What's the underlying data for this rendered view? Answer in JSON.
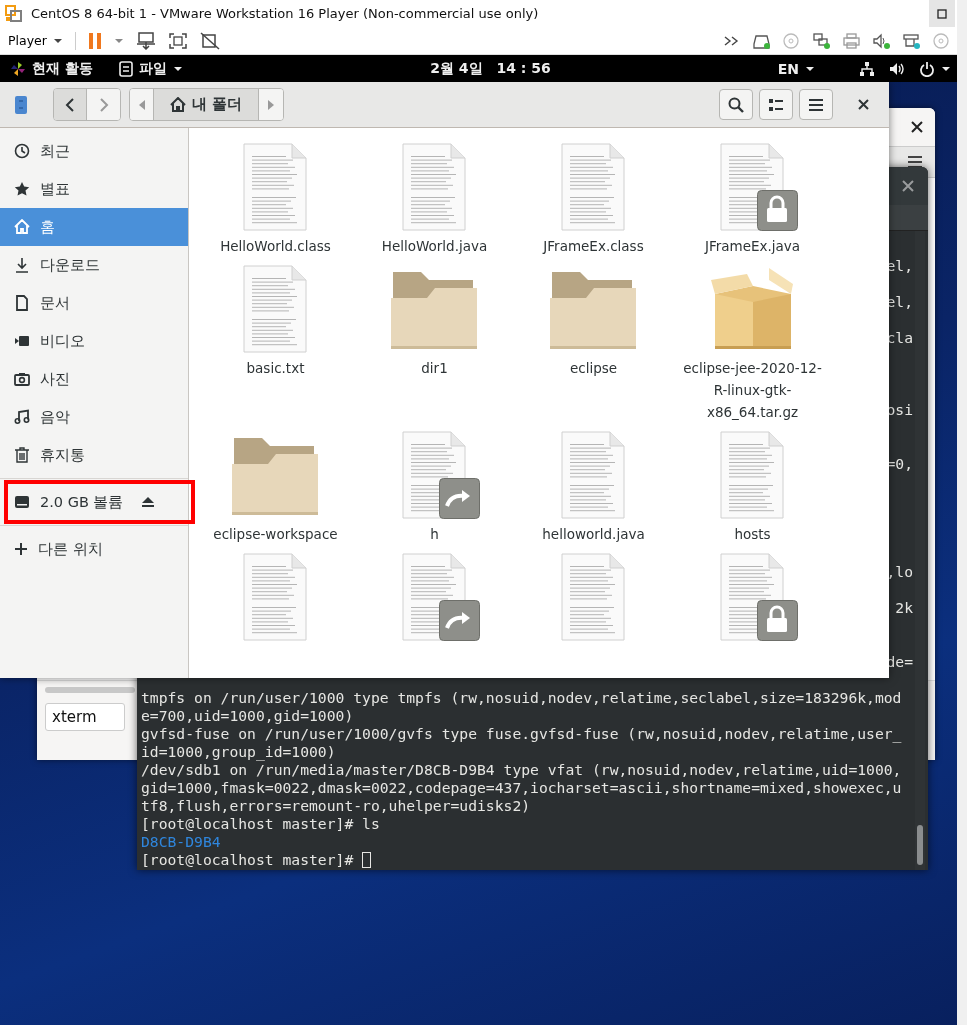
{
  "vm_window": {
    "title": "CentOS 8 64-bit 1 - VMware Workstation 16 Player (Non-commercial use only)",
    "menu": "Player"
  },
  "top_bar": {
    "activities": "현재 활동",
    "app_menu": "파일",
    "date": "2월 4일",
    "time": "14 : 56",
    "input_source": "EN"
  },
  "back_window": {
    "input_value": "xterm"
  },
  "terminal": {
    "clipped_lines": [
      "el,",
      "el,",
      "cla",
      "osi",
      "=0,",
      ",lo",
      "2k",
      "de="
    ],
    "lines": [
      {
        "text": "tmpfs on /run/user/1000 type tmpfs (rw,nosuid,nodev,relatime,seclabel,size=183296k,mod",
        "kind": "output"
      },
      {
        "text": "e=700,uid=1000,gid=1000)",
        "kind": "output"
      },
      {
        "text": "gvfsd-fuse on /run/user/1000/gvfs type fuse.gvfsd-fuse (rw,nosuid,nodev,relatime,user_",
        "kind": "output"
      },
      {
        "text": "id=1000,group_id=1000)",
        "kind": "output"
      },
      {
        "text": "/dev/sdb1 on /run/media/master/D8CB-D9B4 type vfat (rw,nosuid,nodev,relatime,uid=1000,",
        "kind": "output"
      },
      {
        "text": "gid=1000,fmask=0022,dmask=0022,codepage=437,iocharset=ascii,shortname=mixed,showexec,u",
        "kind": "output"
      },
      {
        "text": "tf8,flush,errors=remount-ro,uhelper=udisks2)",
        "kind": "output"
      },
      {
        "text": "[root@localhost master]# ls",
        "kind": "output"
      },
      {
        "text": "D8CB-D9B4",
        "kind": "directory"
      },
      {
        "text": "[root@localhost master]# ",
        "kind": "output"
      }
    ],
    "cursor": true
  },
  "files": {
    "path": "내 폴더",
    "sidebar": [
      {
        "label": "최근",
        "selected": false
      },
      {
        "label": "별표",
        "selected": false
      },
      {
        "label": "홈",
        "selected": true
      },
      {
        "label": "다운로드",
        "selected": false
      },
      {
        "label": "문서",
        "selected": false
      },
      {
        "label": "비디오",
        "selected": false
      },
      {
        "label": "사진",
        "selected": false
      },
      {
        "label": "음악",
        "selected": false
      },
      {
        "label": "휴지통",
        "selected": false
      }
    ],
    "volume": {
      "label": "2.0 GB 볼륨",
      "highlighted": true
    },
    "other_locations": "다른 위치",
    "items": [
      {
        "name": "HelloWorld.class",
        "kind": "document",
        "read_only": false,
        "symlink": false
      },
      {
        "name": "HelloWorld.java",
        "kind": "document",
        "read_only": false,
        "symlink": false
      },
      {
        "name": "JFrameEx.class",
        "kind": "document",
        "read_only": false,
        "symlink": false
      },
      {
        "name": "JFrameEx.java",
        "kind": "document",
        "read_only": true,
        "symlink": false
      },
      {
        "name": "basic.txt",
        "kind": "document",
        "read_only": false,
        "symlink": false
      },
      {
        "name": "dir1",
        "kind": "folder",
        "read_only": false,
        "symlink": false
      },
      {
        "name": "eclipse",
        "kind": "folder",
        "read_only": false,
        "symlink": false
      },
      {
        "name": "eclipse-jee-2020-12-R-linux-gtk-x86_64.tar.gz",
        "kind": "archive",
        "read_only": false,
        "symlink": false
      },
      {
        "name": "eclipse-workspace",
        "kind": "folder",
        "read_only": false,
        "symlink": false
      },
      {
        "name": "h",
        "kind": "document",
        "read_only": false,
        "symlink": true
      },
      {
        "name": "helloworld.java",
        "kind": "document",
        "read_only": false,
        "symlink": false
      },
      {
        "name": "hosts",
        "kind": "document",
        "read_only": false,
        "symlink": false
      },
      {
        "kind": "document",
        "read_only": false,
        "symlink": false
      },
      {
        "kind": "document",
        "read_only": false,
        "symlink": true
      },
      {
        "kind": "document",
        "read_only": false,
        "symlink": false
      },
      {
        "kind": "document",
        "read_only": true,
        "symlink": false
      }
    ]
  }
}
